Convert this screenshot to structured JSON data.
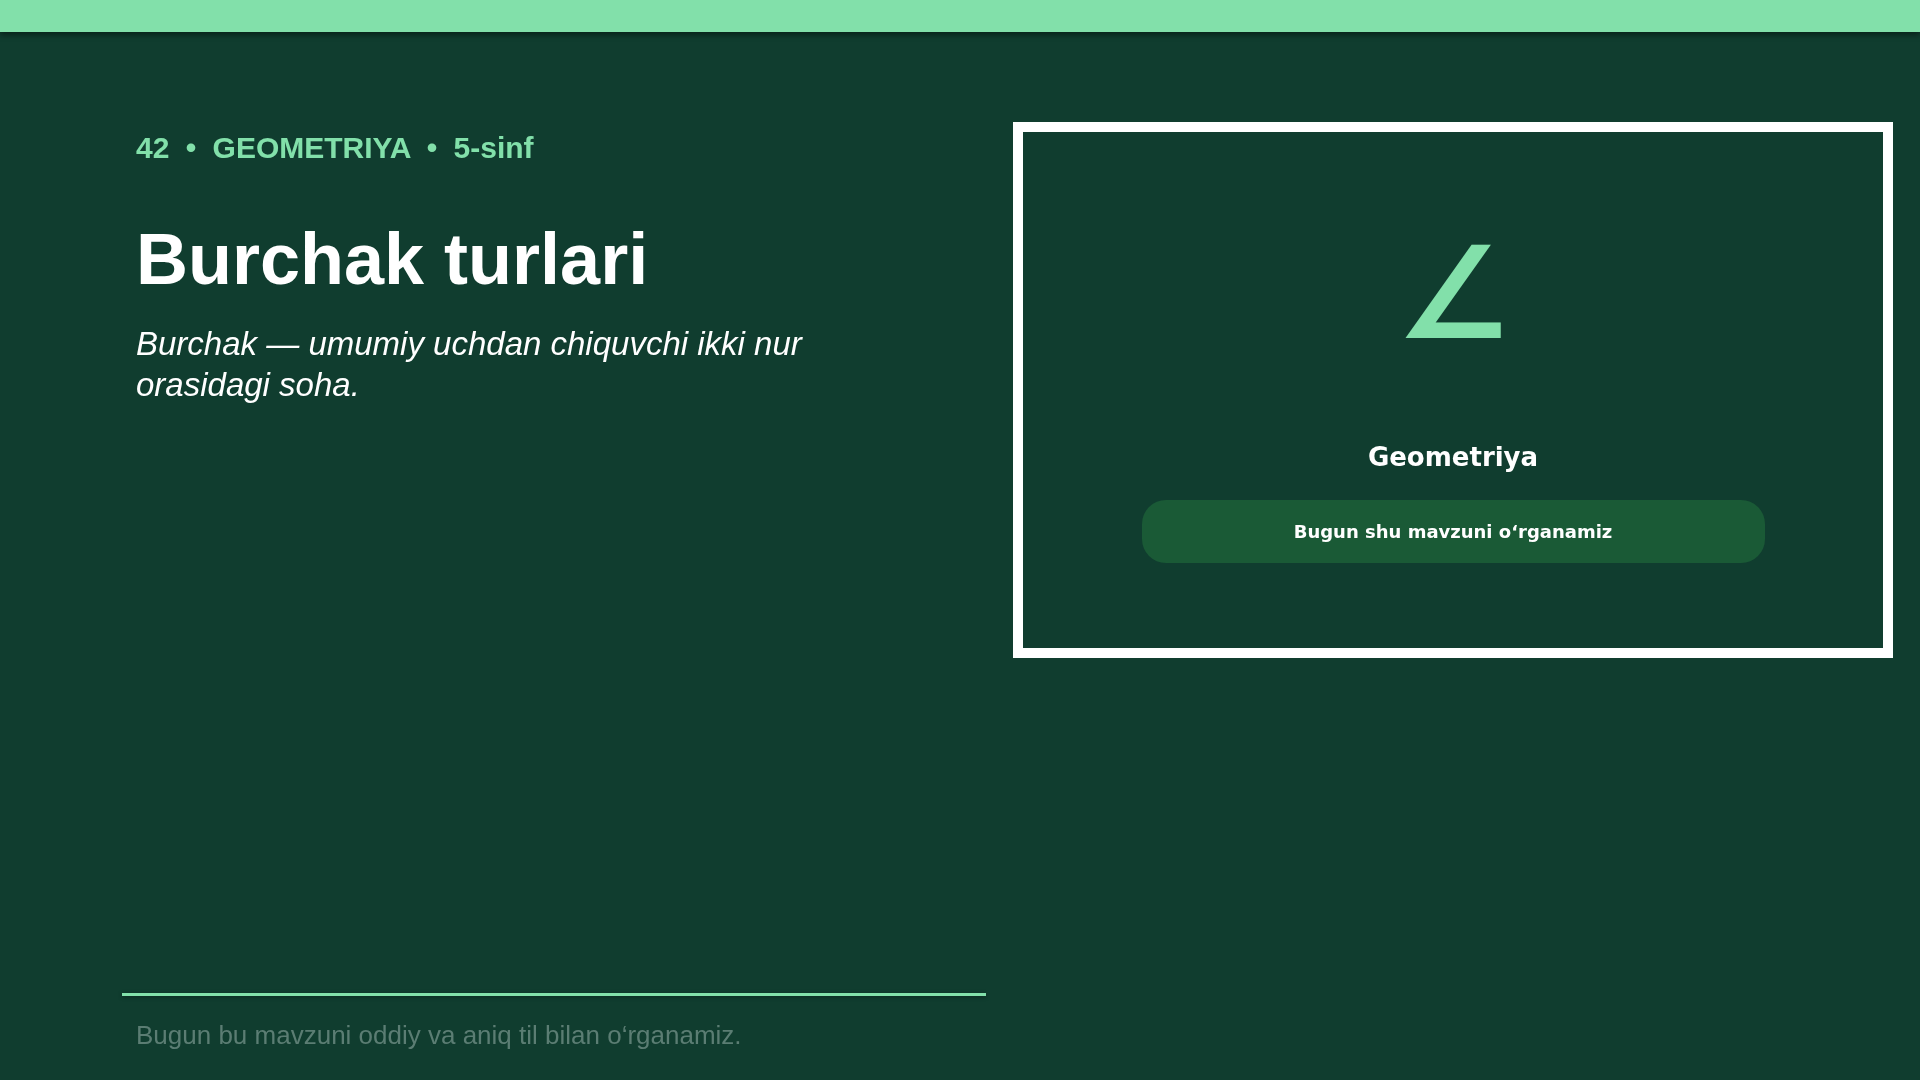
{
  "header": {
    "meta": "42 • GEOMETRIYA • 5-sinf",
    "title": "Burchak turlari",
    "subtitle": "Burchak — umumiy uchdan chiquvchi ikki nur orasidagi soha."
  },
  "card": {
    "symbol": "∠",
    "subject": "Geometriya",
    "caption": "Bugun shu mavzuni o‘rganamiz"
  },
  "footer": {
    "text": "Bugun bu mavzuni oddiy va aniq til bilan o‘rganamiz."
  }
}
